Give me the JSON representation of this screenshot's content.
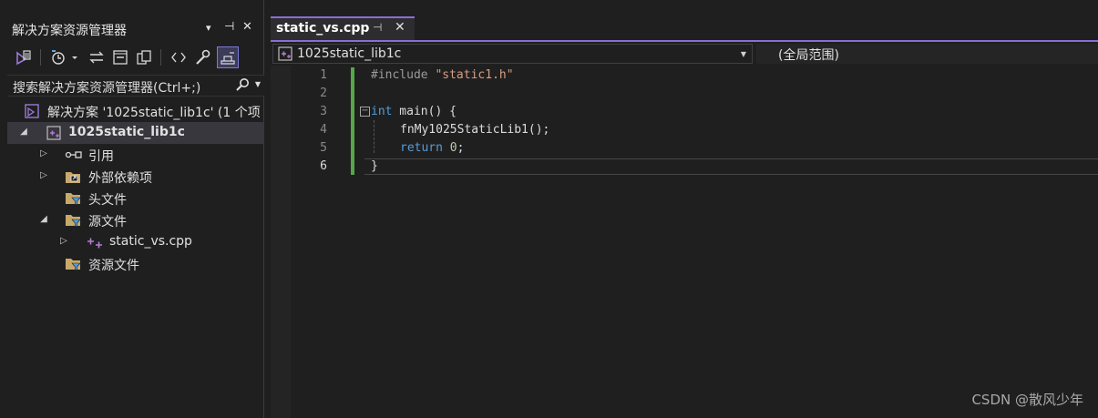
{
  "solution_explorer": {
    "title": "解决方案资源管理器",
    "title_controls": {
      "dropdown": "▾",
      "pin": "⊣",
      "close": "✕"
    },
    "search_placeholder": "搜索解决方案资源管理器(Ctrl+;)",
    "tree": [
      {
        "label": "解决方案 '1025static_lib1c' (1 个项",
        "icon": "solution-icon",
        "expander": ""
      },
      {
        "label": "1025static_lib1c",
        "icon": "cpp-project-icon",
        "expander": "◢",
        "selected": true,
        "bold": true
      },
      {
        "label": "引用",
        "icon": "references-icon",
        "expander": "▷"
      },
      {
        "label": "外部依赖项",
        "icon": "external-deps-icon",
        "expander": "▷"
      },
      {
        "label": "头文件",
        "icon": "filter-folder-icon",
        "expander": ""
      },
      {
        "label": "源文件",
        "icon": "filter-folder-icon",
        "expander": "◢"
      },
      {
        "label": "static_vs.cpp",
        "icon": "cpp-file-icon",
        "expander": "▷"
      },
      {
        "label": "资源文件",
        "icon": "filter-folder-icon",
        "expander": ""
      }
    ]
  },
  "editor": {
    "tab": {
      "title": "static_vs.cpp",
      "pin": "⊣",
      "close": "✕"
    },
    "nav_project": "1025static_lib1c",
    "nav_scope": "(全局范围)",
    "line_numbers": [
      "1",
      "2",
      "3",
      "4",
      "5",
      "6"
    ],
    "current_line": 6,
    "lines": {
      "l1_pp": "#include ",
      "l1_str": "\"static1.h\"",
      "l3_kw": "int",
      "l3_rest": " main() {",
      "l4_fn": "fnMy1025StaticLib1",
      "l4_rest": "();",
      "l5_kw": "return",
      "l5_num": "0",
      "l5_pun": ";",
      "l6": "}"
    }
  },
  "watermark": "CSDN @散风少年",
  "colors": {
    "accent": "#8c6cd6",
    "change_bar": "#57a64a",
    "keyword": "#569cd6",
    "string": "#d69d85"
  }
}
